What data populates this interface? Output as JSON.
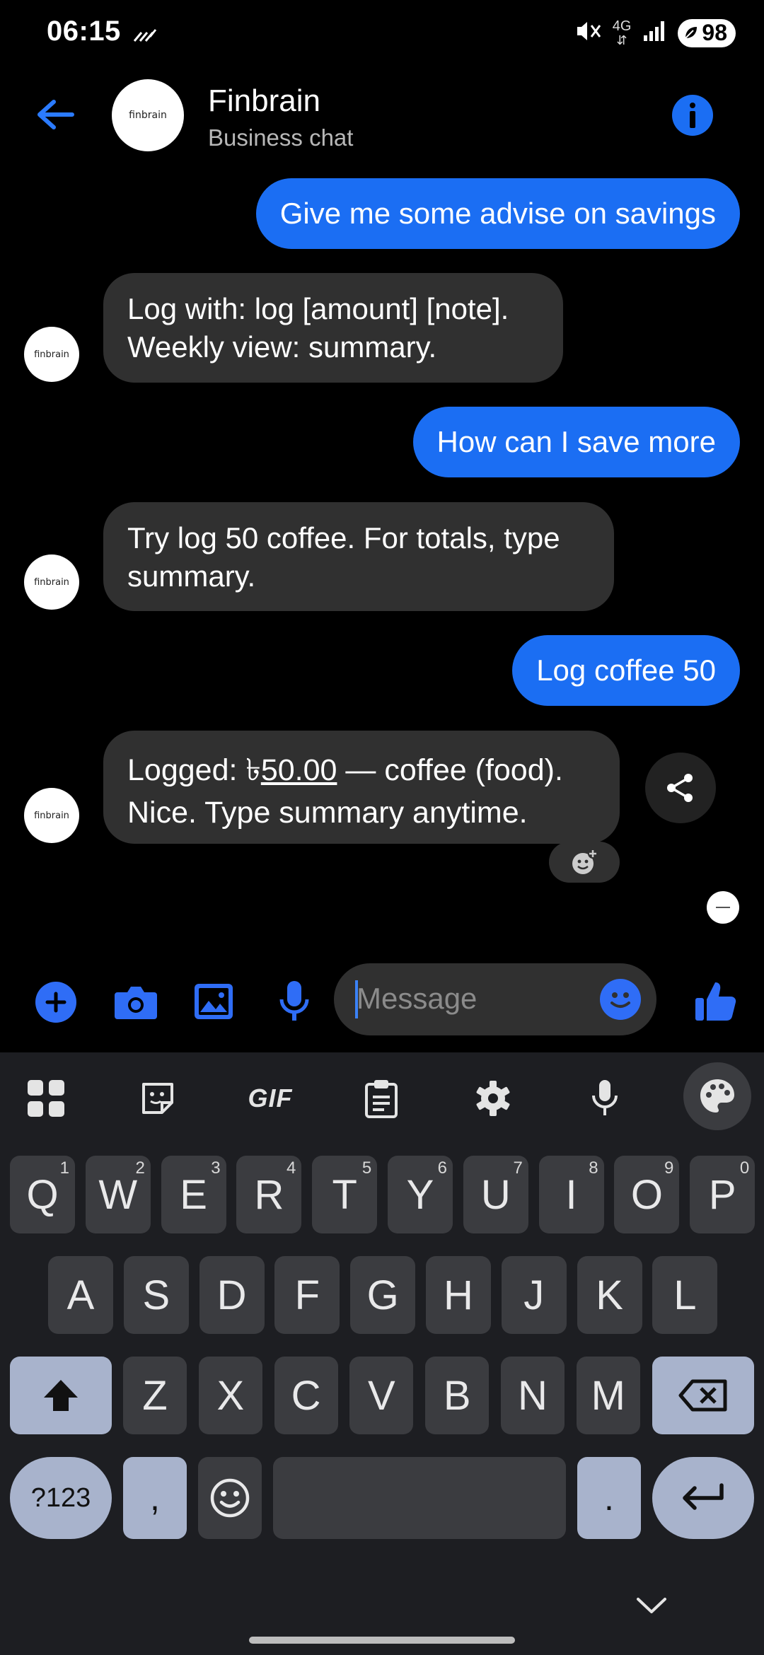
{
  "status": {
    "time": "06:15",
    "battery": "98",
    "network": "4G"
  },
  "header": {
    "title": "Finbrain",
    "subtitle": "Business chat",
    "avatar_text": "finbrain"
  },
  "messages": [
    {
      "from": "user",
      "text": "Give me some advise on savings"
    },
    {
      "from": "bot",
      "lines": [
        "Log with: log [amount] [note].",
        "Weekly view: summary."
      ]
    },
    {
      "from": "user",
      "text": "How can I save more"
    },
    {
      "from": "bot",
      "lines": [
        "Try log 50 coffee. For totals, type",
        "summary."
      ]
    },
    {
      "from": "user",
      "text": "Log coffee 50"
    },
    {
      "from": "bot",
      "line1_prefix": "Logged: ৳",
      "line1_amount": "50.00",
      "line1_suffix": " — coffee (food).",
      "line2": "Nice. Type summary anytime."
    }
  ],
  "compose": {
    "placeholder": "Message"
  },
  "keyboard": {
    "toolbar": [
      "apps-icon",
      "sticker-icon",
      "GIF",
      "clipboard-icon",
      "settings-icon",
      "mic-icon",
      "palette-icon"
    ],
    "row1": [
      {
        "k": "Q",
        "n": "1"
      },
      {
        "k": "W",
        "n": "2"
      },
      {
        "k": "E",
        "n": "3"
      },
      {
        "k": "R",
        "n": "4"
      },
      {
        "k": "T",
        "n": "5"
      },
      {
        "k": "Y",
        "n": "6"
      },
      {
        "k": "U",
        "n": "7"
      },
      {
        "k": "I",
        "n": "8"
      },
      {
        "k": "O",
        "n": "9"
      },
      {
        "k": "P",
        "n": "0"
      }
    ],
    "row2": [
      "A",
      "S",
      "D",
      "F",
      "G",
      "H",
      "J",
      "K",
      "L"
    ],
    "row3": [
      "Z",
      "X",
      "C",
      "V",
      "B",
      "N",
      "M"
    ],
    "symbols": "?123",
    "comma": ",",
    "period": "."
  },
  "colors": {
    "accent": "#1b6ef3",
    "bubble_in": "#303030",
    "keyboard_bg": "#1d1e22",
    "key": "#3b3c40",
    "func_key": "#a8b3cc"
  }
}
